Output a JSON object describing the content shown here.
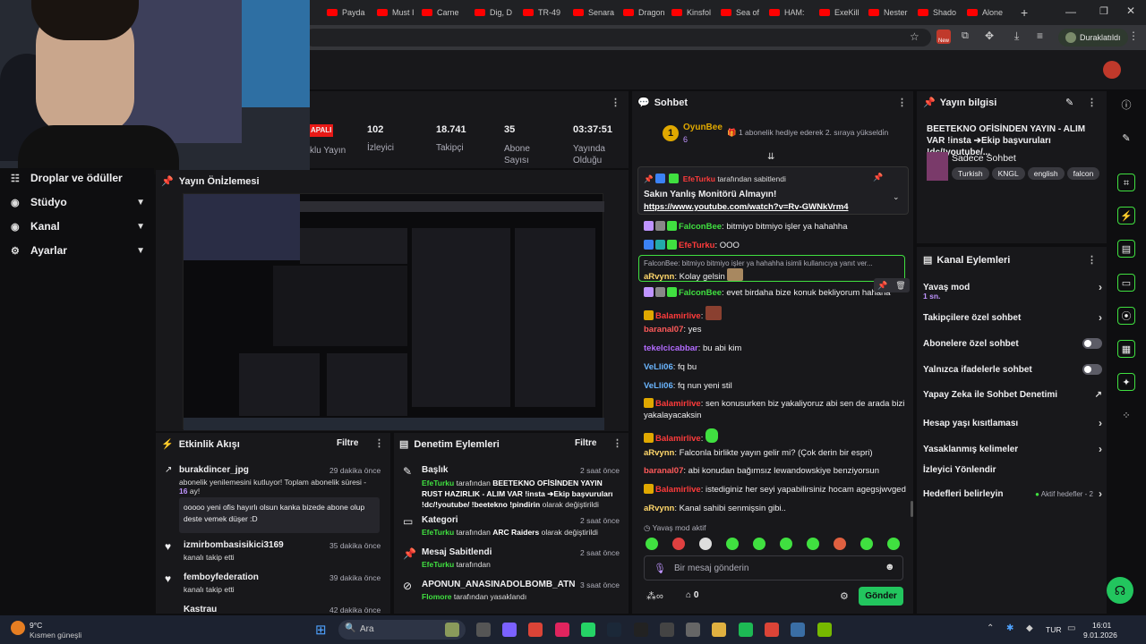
{
  "browser": {
    "tabs": [
      "Payda",
      "Must I",
      "Carne",
      "Dig, D",
      "TR-49",
      "Senara",
      "Dragon",
      "Kinsfol",
      "Sea of",
      "HAM:",
      "ExeKill",
      "Nester",
      "Shado",
      "Alone"
    ],
    "new_tab": "+",
    "profile_label": "Duraklatıldı",
    "new_badge": "New"
  },
  "nav": {
    "items": [
      {
        "label": "Droplar ve ödüller",
        "icon": "drops-icon"
      },
      {
        "label": "Stüdyo",
        "icon": "studio-icon"
      },
      {
        "label": "Kanal",
        "icon": "channel-icon"
      },
      {
        "label": "Ayarlar",
        "icon": "settings-icon"
      }
    ]
  },
  "stats": {
    "status": "APALI",
    "viewers": {
      "value": "102",
      "label": "İzleyici"
    },
    "followers": {
      "value": "18.741",
      "label": "Takipçi"
    },
    "subs": {
      "value": "35",
      "label": "Abone Sayısı"
    },
    "uptime": {
      "value": "03:37:51",
      "label": "Yayında Olduğu"
    },
    "partial_label": "klu Yayın"
  },
  "preview": {
    "title": "Yayın Önİzlemesi"
  },
  "activity": {
    "title": "Etkinlik Akışı",
    "filter": "Filtre",
    "items": [
      {
        "user": "burakdincer_jpg",
        "time": "29 dakika önce",
        "text": "abonelik yenilemesini kutluyor! Toplam abonelik süresi -",
        "months": "16",
        "months_suffix": "ay!",
        "message": "ooooo yeni ofis hayırlı olsun kanka bizede abone olup deste vemek düşer :D"
      },
      {
        "user": "izmirbombasisikici3169",
        "time": "35 dakika önce",
        "text": "kanalı takip etti"
      },
      {
        "user": "femboyfederation",
        "time": "39 dakika önce",
        "text": "kanalı takip etti"
      },
      {
        "user": "Kastrau",
        "time": "42 dakika önce",
        "text": ""
      }
    ]
  },
  "moderation": {
    "title": "Denetim Eylemleri",
    "filter": "Filtre",
    "items": [
      {
        "title": "Başlık",
        "time": "2 saat önce",
        "actor": "EfeTurku",
        "text": "tarafından",
        "value": "BEETEKNO OFİSİNDEN YAYIN RUST HAZIRLIK - ALIM VAR !insta ➔Ekip başvuruları !dc/!youtube/ !beetekno !pindirin",
        "suffix": "olarak değiştirildi"
      },
      {
        "title": "Kategori",
        "time": "2 saat önce",
        "actor": "EfeTurku",
        "text": "tarafından",
        "value": "ARC Raiders",
        "suffix": "olarak değiştirildi"
      },
      {
        "title": "Mesaj Sabitlendi",
        "time": "2 saat önce",
        "actor": "EfeTurku",
        "text": "tarafından",
        "value": "",
        "suffix": ""
      },
      {
        "title": "APONUN_ANASINADOLBOMB_ATN",
        "time": "3 saat önce",
        "actor": "Flomore",
        "text": "tarafından yasaklandı",
        "value": "",
        "suffix": ""
      }
    ]
  },
  "chat": {
    "title": "Sohbet",
    "gift": {
      "rank": "1",
      "user": "OyunBee",
      "count": "6",
      "text": "1 abonelik hediye ederek 2. sıraya yükseldi̇n"
    },
    "pinned": {
      "user": "EfeTurku",
      "by": "tarafından sabitlendi",
      "message": "Sakın Yanlış Monitörü Almayın!",
      "link": "https://www.youtube.com/watch?v=Rv-GWNkVrm4"
    },
    "messages": [
      {
        "user": "FalconBee",
        "color": "#40e040",
        "text": "bitmiyo bitmiyo işler ya hahahha"
      },
      {
        "user": "EfeTurku",
        "color": "#ff3b3b",
        "text": "OOO"
      },
      {
        "user": "aRvynn",
        "color": "#ffd76b",
        "text": "Kolay gelsin",
        "reply": "FalconBee: bitmiyo bitmiyo işler ya hahahha isimli kullanıcıya yanıt ver..."
      },
      {
        "user": "FalconBee",
        "color": "#40e040",
        "text": "evet birdaha bize konuk bekliyorum hahaha"
      },
      {
        "user": "Balamirlive",
        "color": "#ff3b3b",
        "text": ""
      },
      {
        "user": "baranal07",
        "color": "#ff5a5a",
        "text": "yes"
      },
      {
        "user": "tekelcicabbar",
        "color": "#b36bff",
        "text": "bu abi kim"
      },
      {
        "user": "VeLli06",
        "color": "#6bb6ff",
        "text": "fq bu"
      },
      {
        "user": "VeLli06",
        "color": "#6bb6ff",
        "text": "fq nun yeni stil"
      },
      {
        "user": "Balamirlive",
        "color": "#ff3b3b",
        "text": "sen konusurken biz yakaliyoruz abi sen de arada bizi yakalayacaksin"
      },
      {
        "user": "Balamirlive",
        "color": "#ff3b3b",
        "text": ""
      },
      {
        "user": "aRvynn",
        "color": "#ffd76b",
        "text": "Falconla birlikte yayın gelir mi? (Çok derin bir espri)"
      },
      {
        "user": "baranal07",
        "color": "#ff5a5a",
        "text": "abi konudan bağımsız lewandowskiye benziyorsun"
      },
      {
        "user": "Balamirlive",
        "color": "#ff3b3b",
        "text": "istediginiz her seyi yapabilirsiniz hocam agegsjwvged"
      },
      {
        "user": "aRvynn",
        "color": "#ffd76b",
        "text": "Kanal sahibi senmişsin gibi.."
      }
    ],
    "slow_mode": "Yavaş mod aktif",
    "input_placeholder": "Bir mesaj gönderin",
    "points": "0",
    "send": "Gönder"
  },
  "stream_info": {
    "title": "Yayın bilgisi",
    "stream_title": "BEETEKNO OFİSİNDEN YAYIN - ALIM VAR !insta ➔Ekip başvuruları !dc/!youtube/...",
    "category": "Sadece Sohbet",
    "tags": [
      "Turkish",
      "KNGL",
      "english",
      "falcon"
    ]
  },
  "channel_actions": {
    "title": "Kanal Eylemleri",
    "items": [
      {
        "label": "Yavaş mod",
        "sub": "1 sn.",
        "control": "chevron"
      },
      {
        "label": "Takipçilere özel sohbet",
        "sub": "",
        "control": "chevron"
      },
      {
        "label": "Abonelere özel sohbet",
        "sub": "",
        "control": "toggle"
      },
      {
        "label": "Yalnızca ifadelerle sohbet",
        "sub": "",
        "control": "toggle"
      },
      {
        "label": "Yapay Zeka ile Sohbet Denetimi",
        "sub": "",
        "control": "external"
      },
      {
        "label": "Hesap yaşı kısıtlaması",
        "sub": "",
        "control": "chevron"
      },
      {
        "label": "Yasaklanmış kelimeler",
        "sub": "",
        "control": "chevron"
      },
      {
        "label": "İzleyici Yönlendir",
        "sub": "",
        "control": "none"
      },
      {
        "label": "Hedefleri belirleyin",
        "sub": "Aktif hedefler - 2",
        "control": "chevron"
      }
    ]
  },
  "taskbar": {
    "weather_temp": "9°C",
    "weather_desc": "Kısmen güneşli",
    "search": "Ara",
    "lang": "TUR",
    "time": "16:01",
    "date": "9.01.2026"
  }
}
